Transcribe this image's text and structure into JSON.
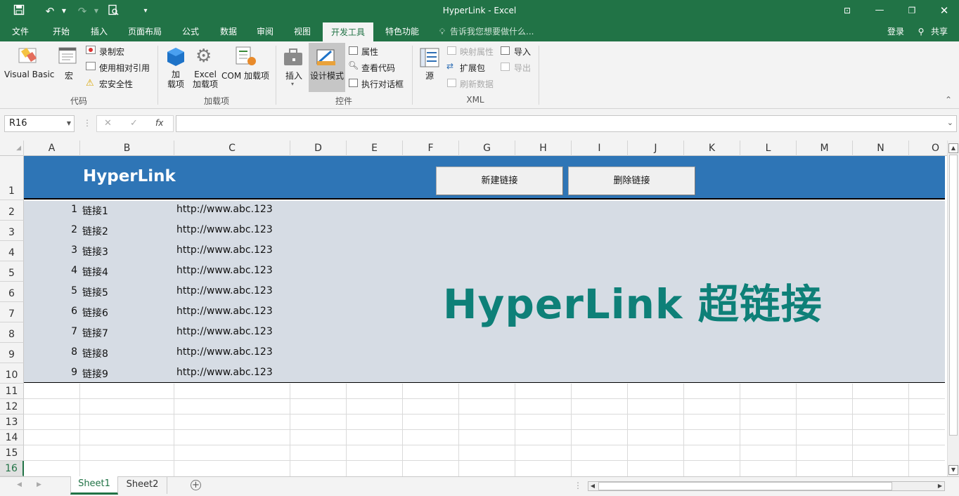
{
  "window": {
    "title": "HyperLink - Excel",
    "login": "登录",
    "share": "共享"
  },
  "tabs": [
    "文件",
    "开始",
    "插入",
    "页面布局",
    "公式",
    "数据",
    "审阅",
    "视图",
    "开发工具",
    "特色功能"
  ],
  "tell_me": "告诉我您想要做什么...",
  "ribbon": {
    "code": {
      "label": "代码",
      "visual_basic": "Visual Basic",
      "macro": "宏",
      "record_macro": "录制宏",
      "relative_ref": "使用相对引用",
      "macro_security": "宏安全性"
    },
    "addins": {
      "label": "加载项",
      "addin": "加\n载项",
      "excel_addin": "Excel\n加载项",
      "com_addin": "COM 加载项"
    },
    "controls": {
      "label": "控件",
      "insert": "插入",
      "design_mode": "设计模式",
      "properties": "属性",
      "view_code": "查看代码",
      "run_dialog": "执行对话框"
    },
    "xml": {
      "label": "XML",
      "source": "源",
      "map_props": "映射属性",
      "expansion": "扩展包",
      "refresh": "刷新数据",
      "import": "导入",
      "export": "导出"
    }
  },
  "formula": {
    "name_box": "R16",
    "fx": "fx",
    "content": ""
  },
  "columns": [
    "A",
    "B",
    "C",
    "D",
    "E",
    "F",
    "G",
    "H",
    "I",
    "J",
    "K",
    "L",
    "M",
    "N",
    "O"
  ],
  "rows": [
    "1",
    "2",
    "3",
    "4",
    "5",
    "6",
    "7",
    "8",
    "9",
    "10",
    "11",
    "12",
    "13",
    "14",
    "15",
    "16"
  ],
  "sheet": {
    "header": "HyperLink",
    "new_link_button": "新建链接",
    "delete_link_button": "删除链接",
    "big_title": "HyperLink 超链接",
    "links": [
      {
        "num": "1",
        "name": "链接1",
        "url": "http://www.abc.123"
      },
      {
        "num": "2",
        "name": "链接2",
        "url": "http://www.abc.123"
      },
      {
        "num": "3",
        "name": "链接3",
        "url": "http://www.abc.123"
      },
      {
        "num": "4",
        "name": "链接4",
        "url": "http://www.abc.123"
      },
      {
        "num": "5",
        "name": "链接5",
        "url": "http://www.abc.123"
      },
      {
        "num": "6",
        "name": "链接6",
        "url": "http://www.abc.123"
      },
      {
        "num": "7",
        "name": "链接7",
        "url": "http://www.abc.123"
      },
      {
        "num": "8",
        "name": "链接8",
        "url": "http://www.abc.123"
      },
      {
        "num": "9",
        "name": "链接9",
        "url": "http://www.abc.123"
      }
    ]
  },
  "sheet_tabs": [
    "Sheet1",
    "Sheet2"
  ],
  "colors": {
    "excel_green": "#217346",
    "header_blue": "#2e75b6",
    "body_gray": "#d6dce4",
    "title_teal": "#0e8078"
  }
}
